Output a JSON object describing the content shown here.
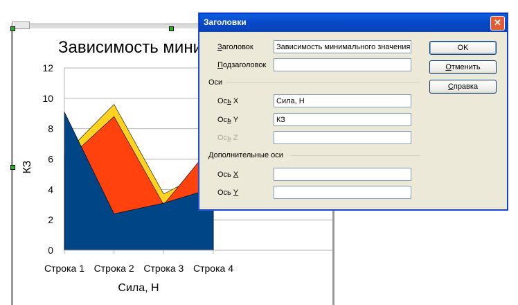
{
  "dialog": {
    "title": "Заголовки",
    "close_symbol": "✕",
    "title_label_a": "З",
    "title_label_b": "аголовок",
    "title_value": "Зависимость минимального значения К",
    "subtitle_label_a": "П",
    "subtitle_label_b": "одзаголовок",
    "subtitle_value": "",
    "axes_section": "Оси",
    "x_label_a": "Ос",
    "x_label_b": "ь",
    "x_label_c": " X",
    "x_value": "Сила, Н",
    "y_label_a": "Ос",
    "y_label_b": "ь",
    "y_label_c": " Y",
    "y_value": "КЗ",
    "z_label_a": "Ос",
    "z_label_b": "ь",
    "z_label_c": " Z",
    "z_value": "",
    "secondary_section": "Дополнительные оси",
    "sx_label_a": "Ось ",
    "sx_label_b": "X",
    "sx_value": "",
    "sy_label_a": "Ось ",
    "sy_label_b": "Y",
    "sy_value": "",
    "ok_label": "OK",
    "cancel_label_a": "О",
    "cancel_label_b": "тменить",
    "help_label_a": "С",
    "help_label_b": "правка"
  },
  "chart_data": {
    "type": "area",
    "title": "Зависимость мини",
    "xlabel": "Сила, Н",
    "ylabel": "КЗ",
    "categories": [
      "Строка 1",
      "Строка 2",
      "Строка 3",
      "Строка 4"
    ],
    "yticks": [
      "0",
      "2",
      "4",
      "6",
      "8",
      "10",
      "12"
    ],
    "ylim": [
      0,
      12
    ],
    "grid": true,
    "series": [
      {
        "color": "#ffd320",
        "values": [
          6.3,
          9.6,
          3.7,
          5.4
        ]
      },
      {
        "color": "#ff420e",
        "values": [
          5.8,
          8.8,
          3.0,
          7.0
        ]
      },
      {
        "color": "#004586",
        "values": [
          9.1,
          2.4,
          3.1,
          4.1
        ]
      }
    ]
  }
}
